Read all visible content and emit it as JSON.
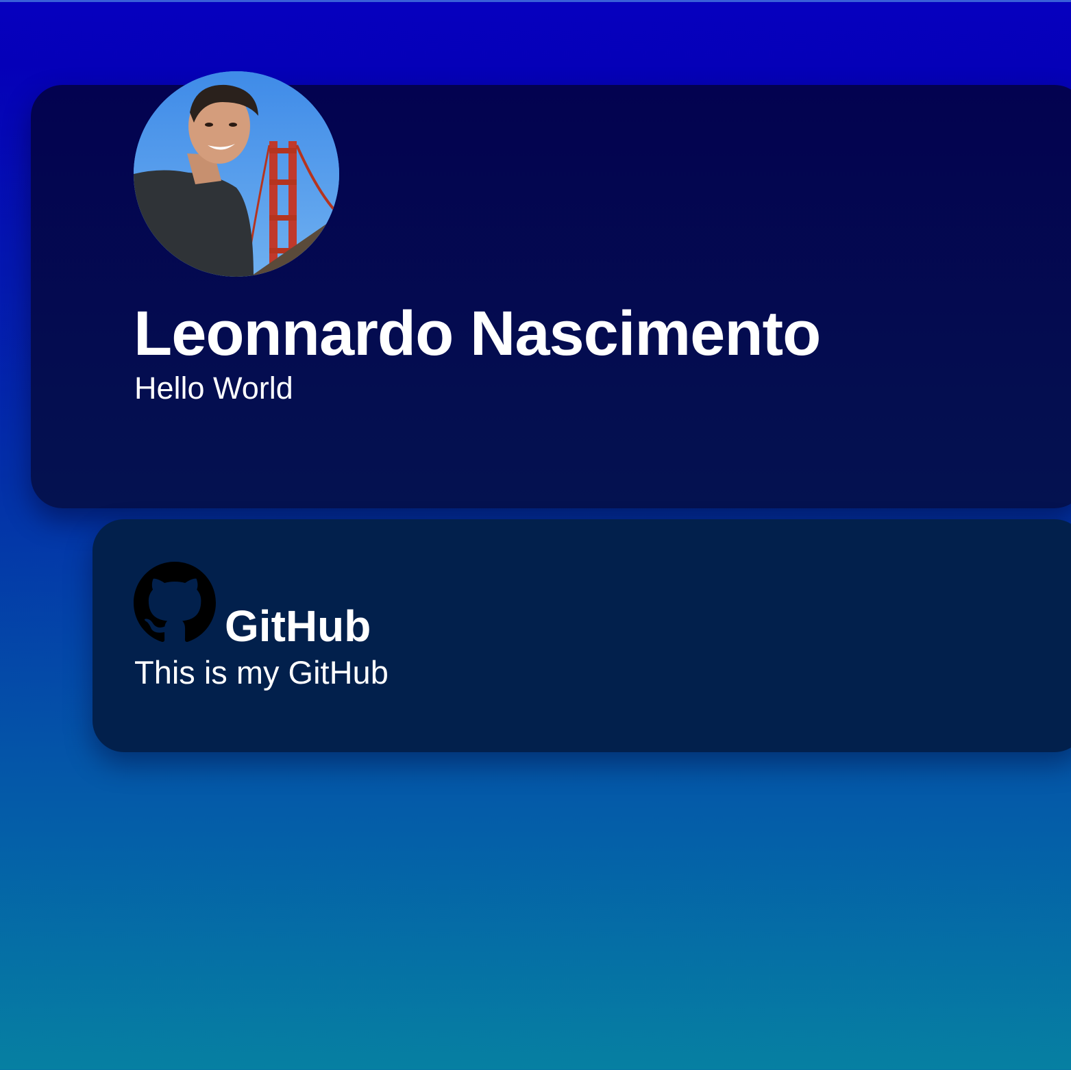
{
  "profile": {
    "name": "Leonnardo Nascimento",
    "tagline": "Hello World",
    "avatar_icon": "avatar-photo"
  },
  "links": [
    {
      "title": "GitHub",
      "description": "This is my GitHub",
      "icon": "github-icon"
    }
  ],
  "colors": {
    "background_top": "#0600bf",
    "background_bottom": "#0680a2",
    "card_profile": "#030250",
    "card_link": "#02204c",
    "text": "#ffffff"
  }
}
